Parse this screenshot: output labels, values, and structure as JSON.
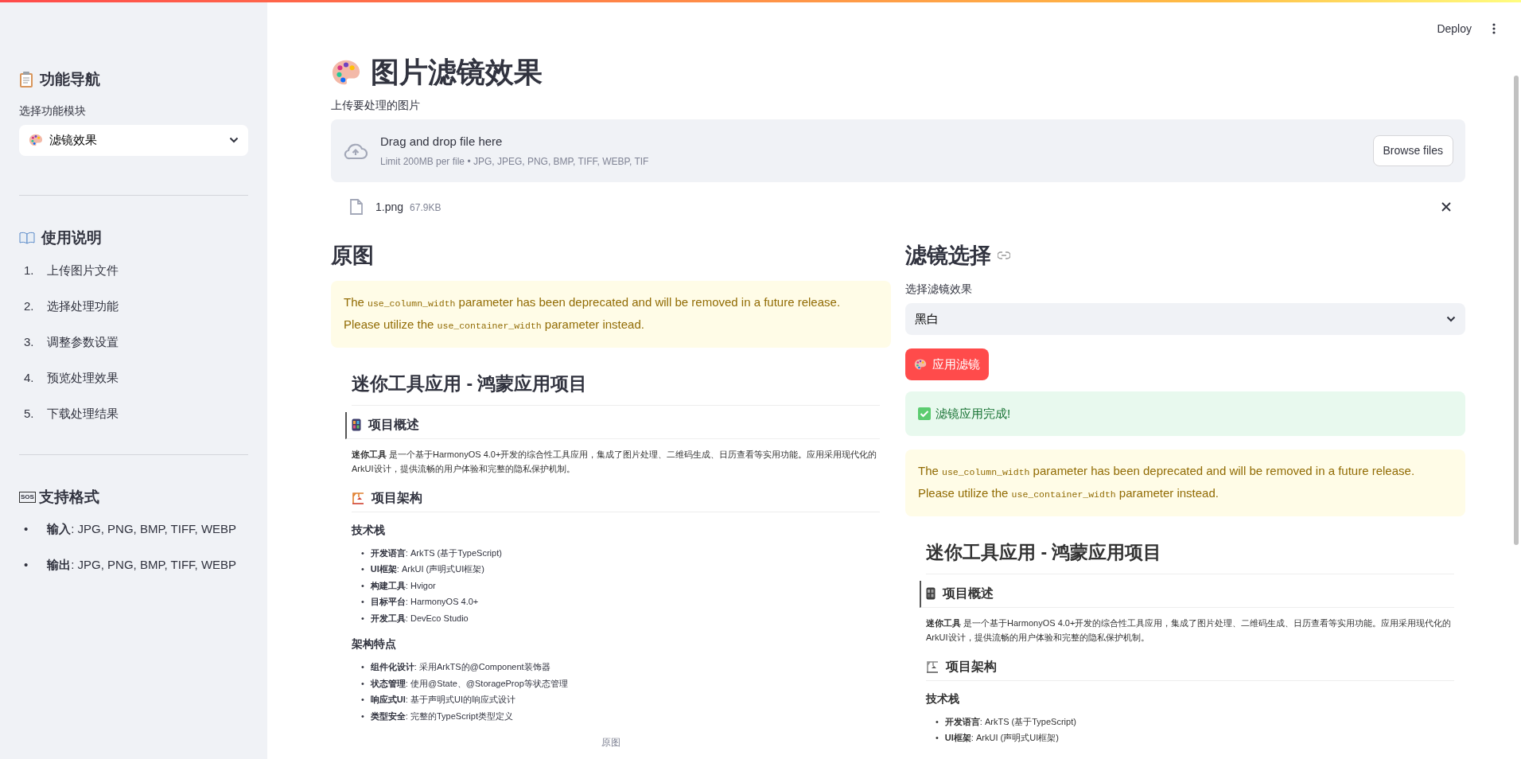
{
  "sidebar": {
    "nav_title": "功能导航",
    "select_label": "选择功能模块",
    "select_value": "滤镜效果",
    "usage_title": "使用说明",
    "steps": [
      {
        "number": "1.",
        "text": "上传图片文件"
      },
      {
        "number": "2.",
        "text": "选择处理功能"
      },
      {
        "number": "3.",
        "text": "调整参数设置"
      },
      {
        "number": "4.",
        "text": "预览处理效果"
      },
      {
        "number": "5.",
        "text": "下载处理结果"
      }
    ],
    "formats_badge": "SOS",
    "formats_title": "支持格式",
    "formats": [
      {
        "marker": "•",
        "label": "输入",
        "value": ": JPG, PNG, BMP, TIFF, WEBP"
      },
      {
        "marker": "•",
        "label": "输出",
        "value": ": JPG, PNG, BMP, TIFF, WEBP"
      }
    ]
  },
  "toolbar": {
    "deploy": "Deploy"
  },
  "title": "图片滤镜效果",
  "uploader": {
    "label": "上传要处理的图片",
    "drop_text": "Drag and drop file here",
    "limit": "Limit 200MB per file • JPG, JPEG, PNG, BMP, TIFF, WEBP, TIF",
    "browse": "Browse files",
    "file_name": "1.png",
    "file_size": "67.9KB"
  },
  "left": {
    "heading": "原图",
    "warning": [
      {
        "kind": "text",
        "text": "The "
      },
      {
        "kind": "code",
        "text": "use_column_width"
      },
      {
        "kind": "text",
        "text": " parameter has been deprecated and will be removed in a future release. Please utilize the "
      },
      {
        "kind": "code",
        "text": "use_container_width"
      },
      {
        "kind": "text",
        "text": " parameter instead."
      }
    ],
    "image": {
      "blocks": [
        {
          "kind": "h1",
          "text": "迷你工具应用 - 鸿蒙应用项目"
        },
        {
          "kind": "h2",
          "quoted": true,
          "text": "项目概述"
        },
        {
          "kind": "para",
          "text": "**迷你工具** 是一个基于HarmonyOS 4.0+开发的综合性工具应用，集成了图片处理、二维码生成、日历查看等实用功能。应用采用现代化的ArkUI设计，提供流畅的用户体验和完整的隐私保护机制。"
        },
        {
          "kind": "h2",
          "quoted": false,
          "text": "项目架构"
        },
        {
          "kind": "h3",
          "text": "技术栈"
        },
        {
          "kind": "bullets",
          "marker": "•",
          "items": [
            "**开发语言**: ArkTS (基于TypeScript)",
            "**UI框架**: ArkUI (声明式UI框架)",
            "**构建工具**: Hvigor",
            "**目标平台**: HarmonyOS 4.0+",
            "**开发工具**: DevEco Studio"
          ]
        },
        {
          "kind": "h3",
          "text": "架构特点"
        },
        {
          "kind": "bullets",
          "marker": "•",
          "items": [
            "**组件化设计**: 采用ArkTS的@Component装饰器",
            "**状态管理**: 使用@State、@StorageProp等状态管理",
            "**响应式UI**: 基于声明式UI的响应式设计",
            "**类型安全**: 完整的TypeScript类型定义"
          ]
        }
      ]
    },
    "caption": "原图"
  },
  "right": {
    "heading": "滤镜选择",
    "select_label": "选择滤镜效果",
    "select_value": "黑白",
    "apply_button": "应用滤镜",
    "success": "滤镜应用完成!",
    "warning": [
      {
        "kind": "text",
        "text": "The "
      },
      {
        "kind": "code",
        "text": "use_column_width"
      },
      {
        "kind": "text",
        "text": " parameter has been deprecated and will be removed in a future release. Please utilize the "
      },
      {
        "kind": "code",
        "text": "use_container_width"
      },
      {
        "kind": "text",
        "text": " parameter instead."
      }
    ],
    "image": {
      "blocks": [
        {
          "kind": "h1",
          "text": "迷你工具应用 - 鸿蒙应用项目"
        },
        {
          "kind": "h2",
          "quoted": true,
          "text": "项目概述"
        },
        {
          "kind": "para",
          "text": "**迷你工具** 是一个基于HarmonyOS 4.0+开发的综合性工具应用，集成了图片处理、二维码生成、日历查看等实用功能。应用采用现代化的ArkUI设计，提供流畅的用户体验和完整的隐私保护机制。"
        },
        {
          "kind": "h2",
          "quoted": false,
          "text": "项目架构"
        },
        {
          "kind": "h3",
          "text": "技术栈"
        },
        {
          "kind": "bullets",
          "marker": "•",
          "items": [
            "**开发语言**: ArkTS (基于TypeScript)",
            "**UI框架**: ArkUI (声明式UI框架)"
          ]
        }
      ]
    }
  }
}
